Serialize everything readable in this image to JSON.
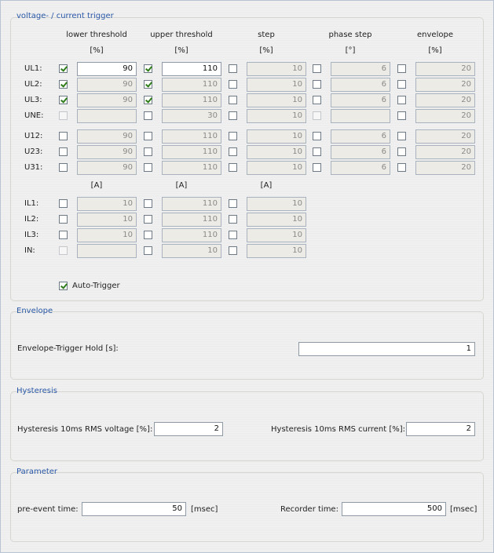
{
  "voltage_group": {
    "title": "voltage- / current trigger",
    "headers": [
      "lower threshold",
      "upper threshold",
      "step",
      "phase step",
      "envelope"
    ],
    "units_pct": [
      "[%]",
      "[%]",
      "[%]",
      "[°]",
      "[%]"
    ],
    "units_amp": [
      "[A]",
      "[A]",
      "[A]"
    ],
    "voltage_rows": [
      {
        "label": "UL1:",
        "lower_chk": true,
        "lower": "90",
        "upper_chk": true,
        "upper": "110",
        "step_chk": false,
        "step": "10",
        "phase_chk": false,
        "phase": "6",
        "env_chk": false,
        "env": "20"
      },
      {
        "label": "UL2:",
        "lower_chk": true,
        "lower": "90",
        "upper_chk": true,
        "upper": "110",
        "step_chk": false,
        "step": "10",
        "phase_chk": false,
        "phase": "6",
        "env_chk": false,
        "env": "20"
      },
      {
        "label": "UL3:",
        "lower_chk": true,
        "lower": "90",
        "upper_chk": true,
        "upper": "110",
        "step_chk": false,
        "step": "10",
        "phase_chk": false,
        "phase": "6",
        "env_chk": false,
        "env": "20"
      },
      {
        "label": "UNE:",
        "lower_chk": false,
        "lower": "",
        "upper_chk": false,
        "upper": "30",
        "step_chk": false,
        "step": "10",
        "phase_chk": false,
        "phase": "",
        "env_chk": false,
        "env": "20"
      }
    ],
    "line_rows": [
      {
        "label": "U12:",
        "lower": "90",
        "upper": "110",
        "step": "10",
        "phase": "6",
        "env": "20"
      },
      {
        "label": "U23:",
        "lower": "90",
        "upper": "110",
        "step": "10",
        "phase": "6",
        "env": "20"
      },
      {
        "label": "U31:",
        "lower": "90",
        "upper": "110",
        "step": "10",
        "phase": "6",
        "env": "20"
      }
    ],
    "current_rows": [
      {
        "label": "IL1:",
        "lower": "10",
        "upper": "110",
        "step": "10"
      },
      {
        "label": "IL2:",
        "lower": "10",
        "upper": "110",
        "step": "10"
      },
      {
        "label": "IL3:",
        "lower": "10",
        "upper": "110",
        "step": "10"
      },
      {
        "label": "IN:",
        "lower": "",
        "upper": "10",
        "step": "10"
      }
    ],
    "auto_trigger_label": "Auto-Trigger",
    "auto_trigger_checked": true
  },
  "envelope": {
    "title": "Envelope",
    "hold_label": "Envelope-Trigger Hold [s]:",
    "hold_value": "1"
  },
  "hysteresis": {
    "title": "Hysteresis",
    "voltage_label": "Hysteresis 10ms RMS voltage [%]:",
    "voltage_value": "2",
    "current_label": "Hysteresis 10ms RMS current [%]:",
    "current_value": "2"
  },
  "parameter": {
    "title": "Parameter",
    "pre_event_label": "pre-event time:",
    "pre_event_value": "50",
    "pre_event_unit": "[msec]",
    "recorder_label": "Recorder time:",
    "recorder_value": "500",
    "recorder_unit": "[msec]"
  }
}
